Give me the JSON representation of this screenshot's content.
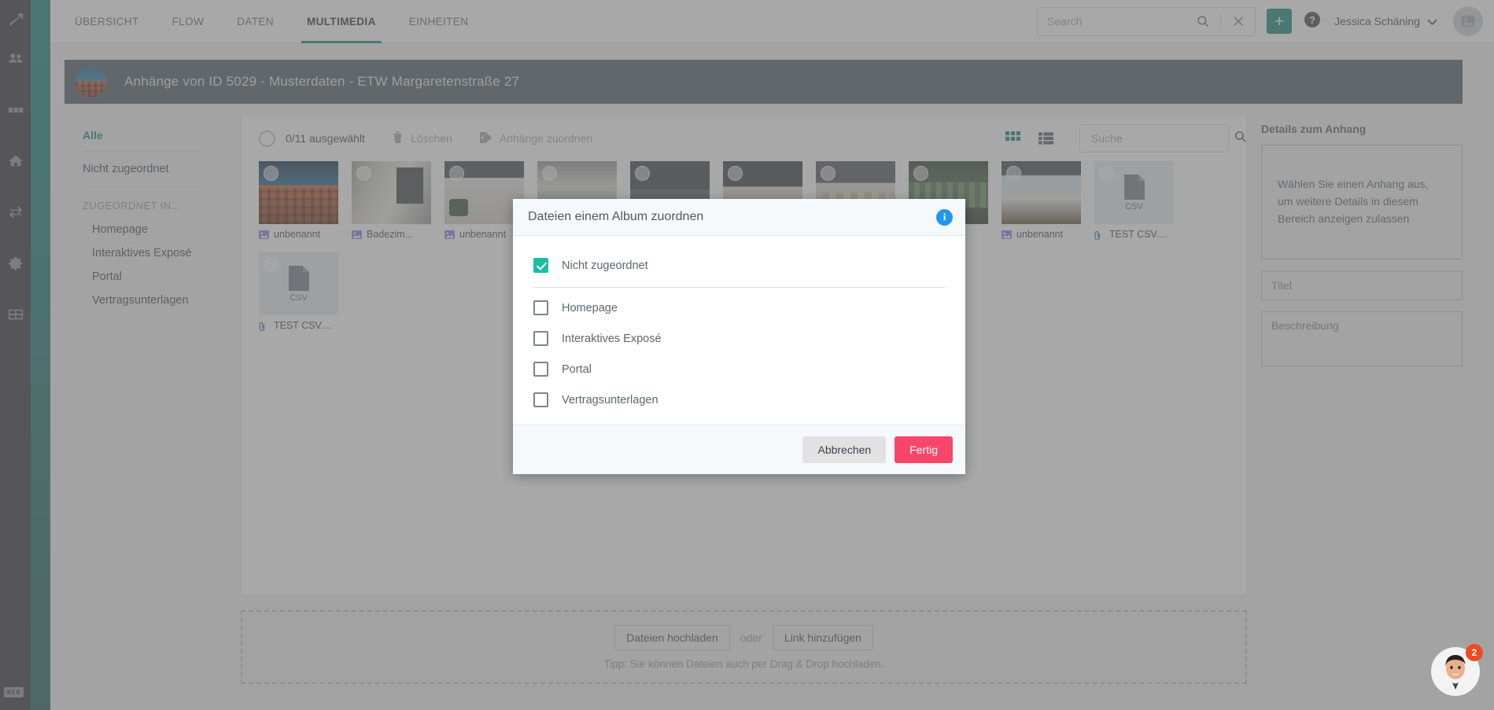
{
  "rail": {
    "items": [
      {
        "name": "logo-icon",
        "label": "NEO"
      },
      {
        "name": "people-icon",
        "label": "Kontakte"
      },
      {
        "name": "columns-icon",
        "label": "Spalten"
      },
      {
        "name": "home-icon",
        "label": "Objekte"
      },
      {
        "name": "sync-icon",
        "label": "Flow"
      },
      {
        "name": "gear-icon",
        "label": "Einstellungen"
      },
      {
        "name": "grid-icon",
        "label": "Module"
      }
    ],
    "badge": "NEO"
  },
  "topbar": {
    "tabs": [
      {
        "label": "ÜBERSICHT",
        "active": false
      },
      {
        "label": "FLOW",
        "active": false
      },
      {
        "label": "DATEN",
        "active": false
      },
      {
        "label": "MULTIMEDIA",
        "active": true
      },
      {
        "label": "EINHEITEN",
        "active": false
      }
    ],
    "search_placeholder": "Search",
    "search_value": "",
    "add_label": "+",
    "username": "Jessica Schäning"
  },
  "banner": {
    "title": "Anhänge von ID 5029 - Musterdaten - ETW Margaretenstraße 27"
  },
  "albums": {
    "all_label": "Alle",
    "unassigned_label": "Nicht zugeordnet",
    "group_title": "ZUGEORDNET IN...",
    "items": [
      {
        "label": "Homepage"
      },
      {
        "label": "Interaktives Exposé"
      },
      {
        "label": "Portal"
      },
      {
        "label": "Vertragsunterlagen"
      }
    ]
  },
  "toolbar": {
    "selection_count": "0/11 ausgewählt",
    "delete_label": "Löschen",
    "assign_label": "Anhänge zuordnen",
    "search_placeholder": "Suche",
    "search_value": "",
    "grid_view_active": true
  },
  "files": [
    {
      "name": "unbenannt",
      "type": "image",
      "style": "ph1"
    },
    {
      "name": "Badezim...",
      "type": "image",
      "style": "ph2"
    },
    {
      "name": "unbenannt",
      "type": "image",
      "style": "ph3"
    },
    {
      "name": "",
      "type": "image",
      "style": "ph4"
    },
    {
      "name": "",
      "type": "image",
      "style": "ph5"
    },
    {
      "name": "",
      "type": "image",
      "style": "ph6"
    },
    {
      "name": "",
      "type": "image",
      "style": "ph7"
    },
    {
      "name": "",
      "type": "image",
      "style": "ph8"
    },
    {
      "name": "unbenannt",
      "type": "image",
      "style": "ph9"
    },
    {
      "name": "TEST CSV....",
      "type": "file",
      "ext": "CSV"
    },
    {
      "name": "TEST CSV....",
      "type": "file",
      "ext": "CSV"
    }
  ],
  "upload": {
    "upload_label": "Dateien hochladen",
    "or_label": "oder",
    "link_label": "Link hinzufügen",
    "tip": "Tipp: Sie können Dateien auch per Drag & Drop hochladen."
  },
  "details": {
    "title": "Details zum Anhang",
    "empty_text": "Wählen Sie einen Anhang aus, um weitere Details in diesem Bereich anzeigen zulassen",
    "title_placeholder": "Titel",
    "description_placeholder": "Beschreibung"
  },
  "modal": {
    "title": "Dateien einem Album zuordnen",
    "info_icon": "i",
    "options": [
      {
        "label": "Nicht zugeordnet",
        "checked": true,
        "separator": true
      },
      {
        "label": "Homepage",
        "checked": false,
        "separator": false
      },
      {
        "label": "Interaktives Exposé",
        "checked": false,
        "separator": false
      },
      {
        "label": "Portal",
        "checked": false,
        "separator": false
      },
      {
        "label": "Vertragsunterlagen",
        "checked": false,
        "separator": false
      }
    ],
    "cancel_label": "Abbrechen",
    "done_label": "Fertig"
  },
  "chat": {
    "badge": "2"
  },
  "colors": {
    "accent_teal": "#0d8074",
    "checkbox_green": "#19bfa2",
    "primary_pink": "#f8466a",
    "info_blue": "#2196f3",
    "badge_orange": "#f04a22"
  }
}
